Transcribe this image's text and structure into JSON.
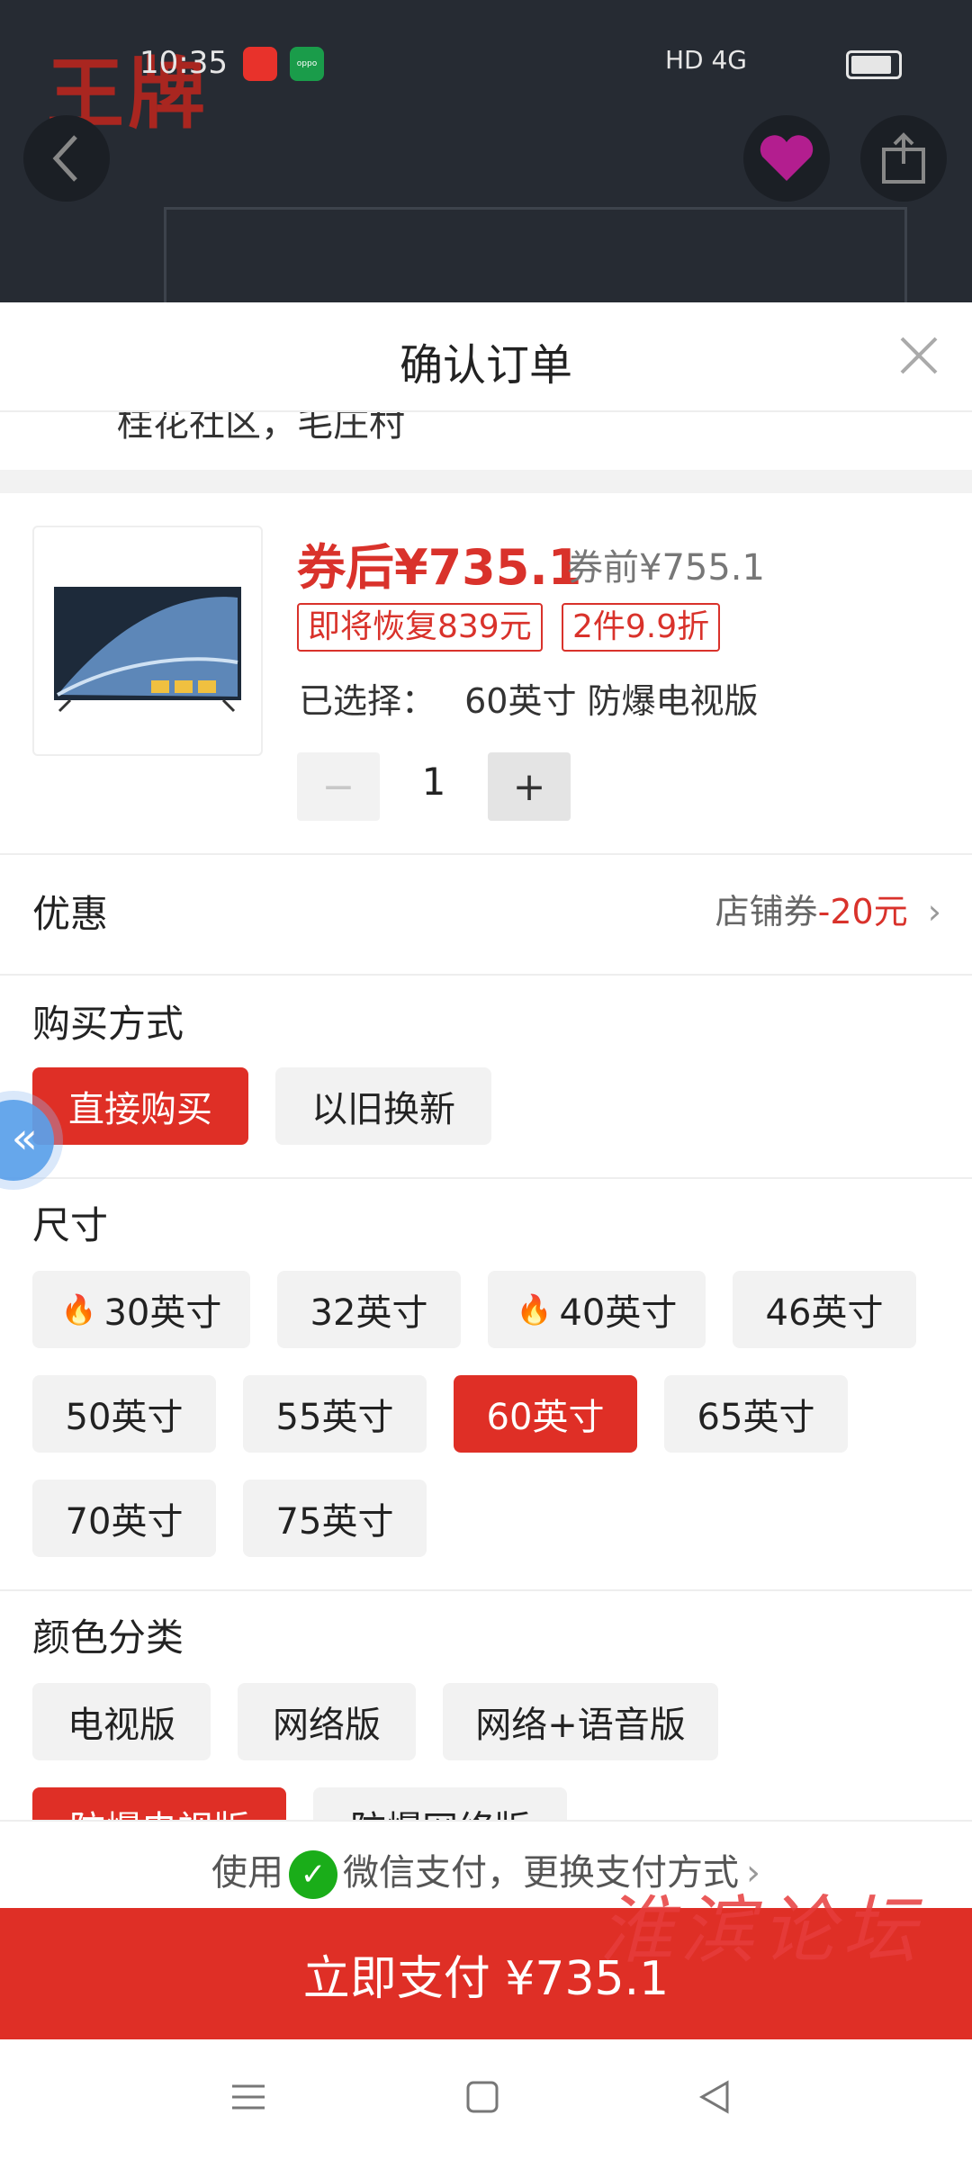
{
  "status_bar": {
    "time": "10:35",
    "app2_label": "oppo",
    "signal_text": "HD 4G"
  },
  "background": {
    "brand_text": "王牌"
  },
  "sheet": {
    "title": "确认订单",
    "address_partial": "桂花社区，毛庄村"
  },
  "product": {
    "price_after_coupon": "券后¥735.1",
    "price_before_coupon": "券前¥755.1",
    "tags": [
      "即将恢复839元",
      "2件9.9折"
    ],
    "selected_label": "已选择：",
    "selected_value": "60英寸 防爆电视版",
    "quantity": "1",
    "minus": "−",
    "plus": "+"
  },
  "discount": {
    "label": "优惠",
    "value_prefix": "店铺券",
    "value_amount": "-20元"
  },
  "purchase_method": {
    "label": "购买方式",
    "options": [
      "直接购买",
      "以旧换新"
    ],
    "selected": "直接购买"
  },
  "size": {
    "label": "尺寸",
    "options": [
      "30英寸",
      "32英寸",
      "40英寸",
      "46英寸",
      "50英寸",
      "55英寸",
      "60英寸",
      "65英寸",
      "70英寸",
      "75英寸"
    ],
    "hot": [
      "30英寸",
      "40英寸"
    ],
    "selected": "60英寸"
  },
  "color": {
    "label": "颜色分类",
    "options": [
      "电视版",
      "网络版",
      "网络+语音版",
      "防爆电视版",
      "防爆网络版"
    ],
    "selected": "防爆电视版"
  },
  "payment": {
    "use": "使用",
    "method": "微信支付，更换支付方式",
    "pay_button": "立即支付 ¥735.1"
  },
  "watermark": "淮滨论坛",
  "colors": {
    "accent": "#df2f26",
    "wechat": "#1aad19"
  }
}
